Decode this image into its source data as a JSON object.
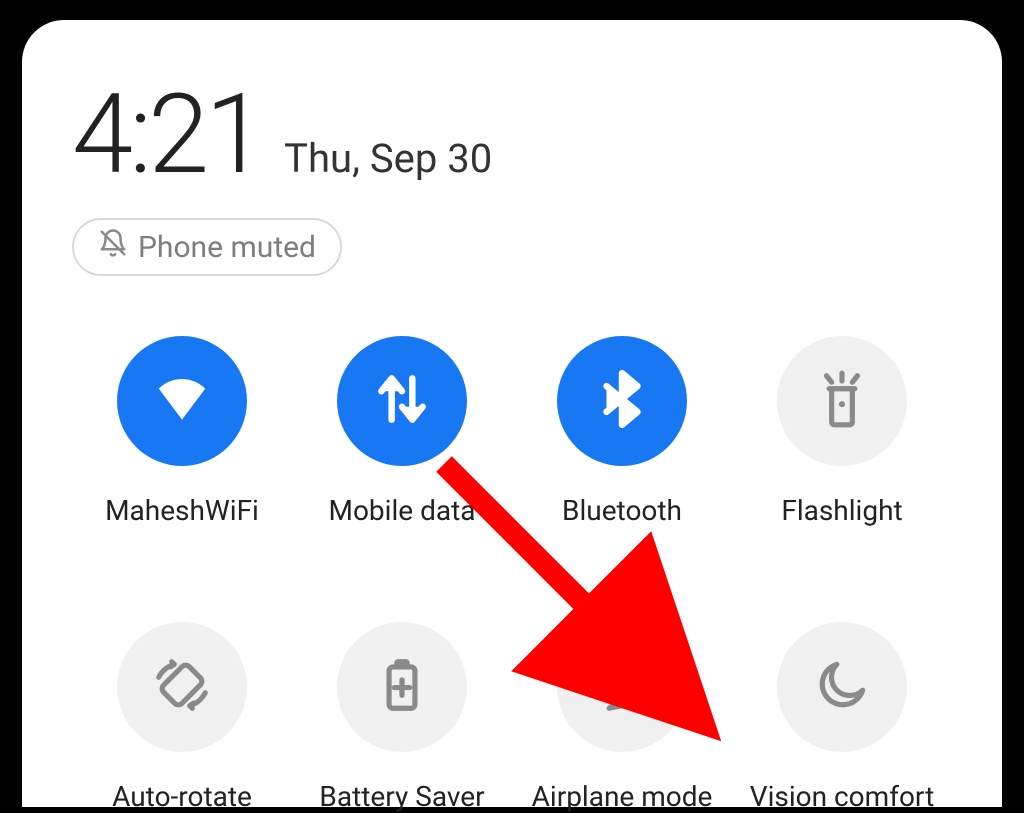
{
  "header": {
    "time": "4:21",
    "date": "Thu, Sep 30"
  },
  "status_pill": {
    "label": "Phone muted"
  },
  "tiles": [
    {
      "label": "MaheshWiFi",
      "active": true,
      "icon": "wifi-icon"
    },
    {
      "label": "Mobile data",
      "active": true,
      "icon": "mobile-data-icon"
    },
    {
      "label": "Bluetooth",
      "active": true,
      "icon": "bluetooth-icon"
    },
    {
      "label": "Flashlight",
      "active": false,
      "icon": "flashlight-icon"
    },
    {
      "label": "Auto-rotate",
      "active": false,
      "icon": "auto-rotate-icon"
    },
    {
      "label": "Battery Saver",
      "active": false,
      "icon": "battery-saver-icon"
    },
    {
      "label": "Airplane mode",
      "active": false,
      "icon": "airplane-mode-icon"
    },
    {
      "label": "Vision comfort",
      "active": false,
      "icon": "vision-comfort-icon"
    }
  ],
  "annotation": {
    "type": "arrow",
    "color": "#ff0000",
    "points_to": "Airplane mode"
  }
}
